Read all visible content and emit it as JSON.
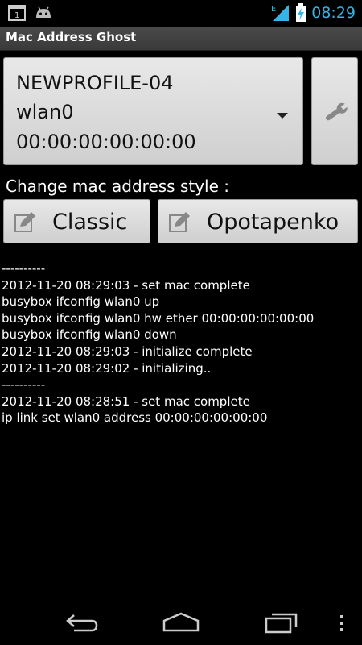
{
  "status_bar": {
    "time": "08:29",
    "network_type": "E",
    "icons": [
      "screen-icon",
      "android-icon",
      "signal-icon",
      "battery-charging-icon"
    ]
  },
  "app": {
    "title": "Mac Address Ghost"
  },
  "profile": {
    "name": "NEWPROFILE-04",
    "interface": "wlan0",
    "mac": "00:00:00:00:00:00"
  },
  "style_section": {
    "label": "Change mac address style :",
    "classic": "Classic",
    "opotapenko": "Opotapenko"
  },
  "log": [
    "----------",
    "2012-11-20 08:29:03 - set mac complete",
    "busybox ifconfig wlan0 up",
    "busybox ifconfig wlan0 hw ether 00:00:00:00:00:00",
    "busybox ifconfig wlan0 down",
    "2012-11-20 08:29:03 - initialize complete",
    "2012-11-20 08:29:02 - initializing..",
    "----------",
    "2012-11-20 08:28:51 - set mac complete",
    "ip link set wlan0 address 00:00:00:00:00:00"
  ],
  "colors": {
    "accent": "#33b5e5",
    "background": "#000000",
    "button": "#d9d9d9"
  }
}
